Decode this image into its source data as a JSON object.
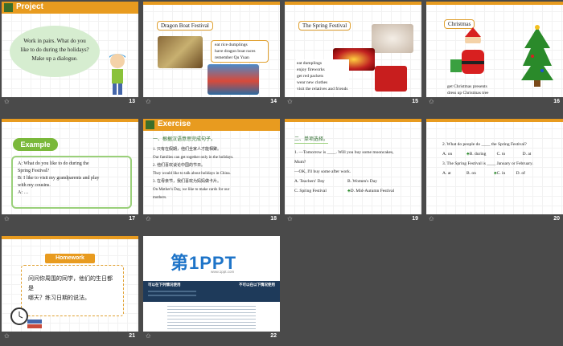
{
  "slides": [
    {
      "num": "13",
      "title": "Project",
      "bubble": [
        "Work in pairs. What do you",
        "like to do during the holidays?",
        "Make up a dialogue."
      ]
    },
    {
      "num": "14",
      "title": "Dragon Boat Festival",
      "notes": [
        "eat rice dumplings",
        "have dragon boat races",
        "remember Qu Yuan"
      ]
    },
    {
      "num": "15",
      "title": "The Spring Festival",
      "notes": [
        "eat dumplings",
        "enjoy fireworks",
        "get red packets",
        "wear new clothes",
        "visit the relatives and friends"
      ]
    },
    {
      "num": "16",
      "title": "Christmas",
      "notes": [
        "get Christmas presents",
        "dress up Christmas tree"
      ]
    },
    {
      "num": "17",
      "title": "Example",
      "lines": [
        "A: What do you like to do during the",
        "Spring Festival?",
        "B: I like to visit my grandparents and play",
        "with my cousins.",
        "A: …"
      ]
    },
    {
      "num": "18",
      "title": "Exercise",
      "subtitle": "一、根据汉语意思完成句子。",
      "lines": [
        "1. 只有在假期，他们全家人才能相聚。",
        "Our families can  get   together  only in the holidays.",
        "2. 他们喜欢谈论中国的节日。",
        "They  would    like    to  talk about holidays in China.",
        "3. 在母亲节，我们喜欢为妈妈做卡片。",
        "On Mother's Day, we like to   make   cards  for our",
        "mothers."
      ]
    },
    {
      "num": "19",
      "subtitle": "二、单项选择。",
      "lines": [
        "1. —Tomorrow is ____. Will you buy some mooncakes,",
        "Mum?",
        "—OK, I'll buy some after work.",
        "A. Teachers' Day",
        "B. Women's Day",
        "C. Spring Festival",
        "D. Mid-Autumn Festival"
      ]
    },
    {
      "num": "20",
      "lines": [
        "2. What do people do ____ the Spring Festival?",
        "A. on",
        "B. during",
        "C. to",
        "D. at",
        "3. The Spring Festival is ____ January or February.",
        "A. at",
        "B. on",
        "C. in",
        "D. of"
      ]
    },
    {
      "num": "21",
      "title": "Homework",
      "lines": [
        "问问你周围的同学，他们的生日都是",
        "哪天？练习日期的说法。"
      ]
    },
    {
      "num": "22",
      "logo": "第1PPT",
      "logo_sub": "www.1ppt.com",
      "left_head": "可以在下列情况使用",
      "right_head": "不可以在以下情况使用"
    }
  ],
  "colors": {
    "background": "#4a4a4a",
    "header": "#e89b1f",
    "accent_green": "#3b6e2a"
  }
}
